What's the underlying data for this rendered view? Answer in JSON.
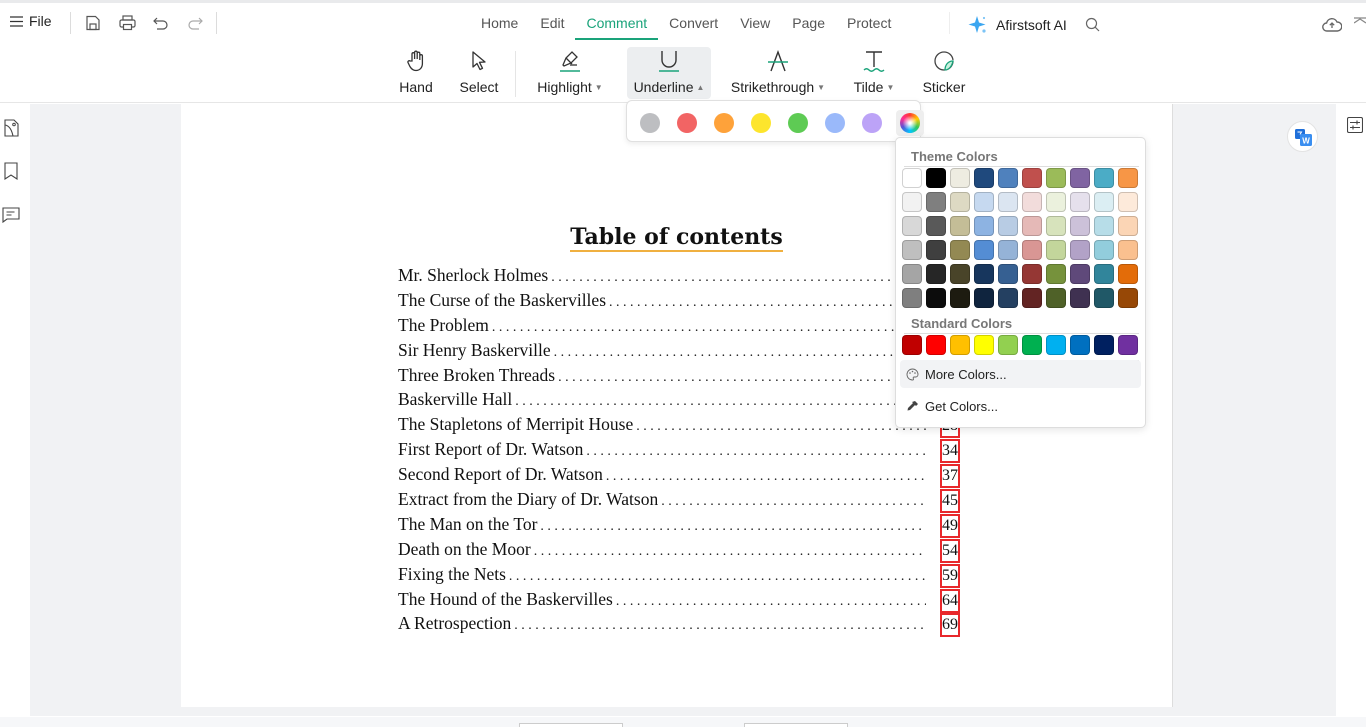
{
  "titlebar": {
    "file_label": "File",
    "tabs": [
      "Home",
      "Edit",
      "Comment",
      "Convert",
      "View",
      "Page",
      "Protect"
    ],
    "active_tab": "Comment",
    "ai_label": "Afirstsoft AI"
  },
  "ribbon": {
    "tools": {
      "hand": "Hand",
      "select": "Select",
      "highlight": "Highlight",
      "underline": "Underline",
      "strikethrough": "Strikethrough",
      "tilde": "Tilde",
      "sticker": "Sticker"
    },
    "active_tool": "Underline",
    "accent_color": "#1aa37a"
  },
  "quick_colors": [
    "#bdbec1",
    "#f26464",
    "#fea23a",
    "#fde52d",
    "#5ecb54",
    "#9ab9fa",
    "#bca3f7"
  ],
  "palette": {
    "theme_heading": "Theme Colors",
    "theme_rows": [
      [
        "#ffffff",
        "#000000",
        "#eeece1",
        "#1f497d",
        "#4f81bd",
        "#c0504d",
        "#9bbb59",
        "#8064a2",
        "#4bacc6",
        "#f79646"
      ],
      [
        "#f2f2f2",
        "#7f7f7f",
        "#ddd9c3",
        "#c6d9f0",
        "#dbe5f1",
        "#f2dcdb",
        "#ebf1dd",
        "#e5e0ec",
        "#dbeef3",
        "#fdeada"
      ],
      [
        "#d8d8d8",
        "#595959",
        "#c4bd97",
        "#8db3e2",
        "#b8cce4",
        "#e5b9b7",
        "#d7e3bc",
        "#ccc1d9",
        "#b7dde8",
        "#fbd5b5"
      ],
      [
        "#bfbfbf",
        "#3f3f3f",
        "#938953",
        "#548dd4",
        "#95b3d7",
        "#d99694",
        "#c3d69b",
        "#b2a2c7",
        "#92cddc",
        "#fac08f"
      ],
      [
        "#a5a5a5",
        "#262626",
        "#494429",
        "#17365d",
        "#366092",
        "#953734",
        "#76923c",
        "#5f497a",
        "#31859b",
        "#e36c09"
      ],
      [
        "#7f7f7f",
        "#0c0c0c",
        "#1d1b10",
        "#0f243e",
        "#244061",
        "#632423",
        "#4f6128",
        "#3f3151",
        "#205867",
        "#974806"
      ]
    ],
    "standard_heading": "Standard Colors",
    "standard": [
      "#c00000",
      "#ff0000",
      "#ffc000",
      "#ffff00",
      "#92d050",
      "#00b050",
      "#00b0f0",
      "#0070c0",
      "#002060",
      "#7030a0"
    ],
    "more_colors": "More Colors...",
    "get_colors": "Get Colors..."
  },
  "document": {
    "title": "Table of contents",
    "entries": [
      {
        "title": "Mr. Sherlock Holmes",
        "page": ""
      },
      {
        "title": "The Curse of the Baskervilles",
        "page": ""
      },
      {
        "title": "The Problem",
        "page": ""
      },
      {
        "title": "Sir Henry Baskerville",
        "page": ""
      },
      {
        "title": "Three Broken Threads",
        "page": ""
      },
      {
        "title": "Baskerville Hall",
        "page": ""
      },
      {
        "title": "The Stapletons of Merripit House",
        "page": "28"
      },
      {
        "title": "First Report of Dr. Watson",
        "page": "34"
      },
      {
        "title": "Second Report of Dr. Watson",
        "page": "37"
      },
      {
        "title": "Extract from the Diary of Dr. Watson",
        "page": "45"
      },
      {
        "title": "The Man on the Tor",
        "page": "49"
      },
      {
        "title": "Death on the Moor",
        "page": "54"
      },
      {
        "title": "Fixing the Nets",
        "page": "59"
      },
      {
        "title": "The Hound of the Baskervilles",
        "page": "64"
      },
      {
        "title": "A Retrospection",
        "page": "69"
      }
    ]
  }
}
